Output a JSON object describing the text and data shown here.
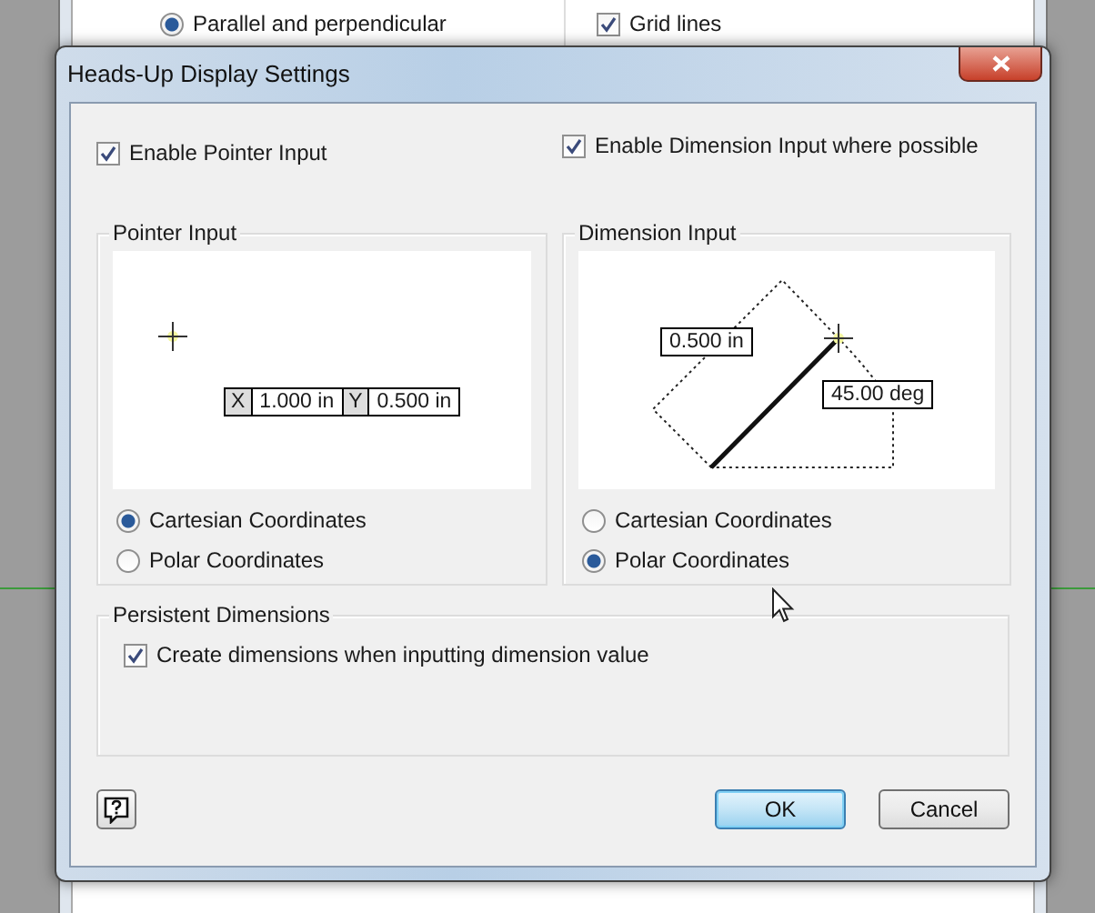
{
  "background_window": {
    "radio": {
      "label": "Parallel and perpendicular",
      "selected": true
    },
    "checkbox": {
      "label": "Grid lines",
      "checked": true
    }
  },
  "dialog": {
    "title": "Heads-Up Display Settings",
    "options": [
      {
        "label": "Enable Pointer Input",
        "checked": true
      },
      {
        "label": "Enable Dimension Input where possible",
        "checked": true
      }
    ],
    "groups": [
      {
        "title": "Pointer Input",
        "kind": "pointer",
        "preview": {
          "x_label": "X",
          "x_value": "1.000 in",
          "y_label": "Y",
          "y_value": "0.500 in"
        },
        "radios": [
          {
            "label": "Cartesian Coordinates",
            "selected": true
          },
          {
            "label": "Polar Coordinates",
            "selected": false
          }
        ]
      },
      {
        "title": "Dimension Input",
        "kind": "dimension",
        "preview": {
          "length": "0.500 in",
          "angle": "45.00 deg"
        },
        "radios": [
          {
            "label": "Cartesian Coordinates",
            "selected": false
          },
          {
            "label": "Polar Coordinates",
            "selected": true
          }
        ]
      }
    ],
    "persistent": {
      "title": "Persistent Dimensions",
      "checkbox": {
        "label": "Create dimensions when inputting dimension value",
        "checked": true
      }
    },
    "buttons": [
      {
        "label": "OK",
        "default": true
      },
      {
        "label": "Cancel",
        "default": false
      }
    ]
  }
}
